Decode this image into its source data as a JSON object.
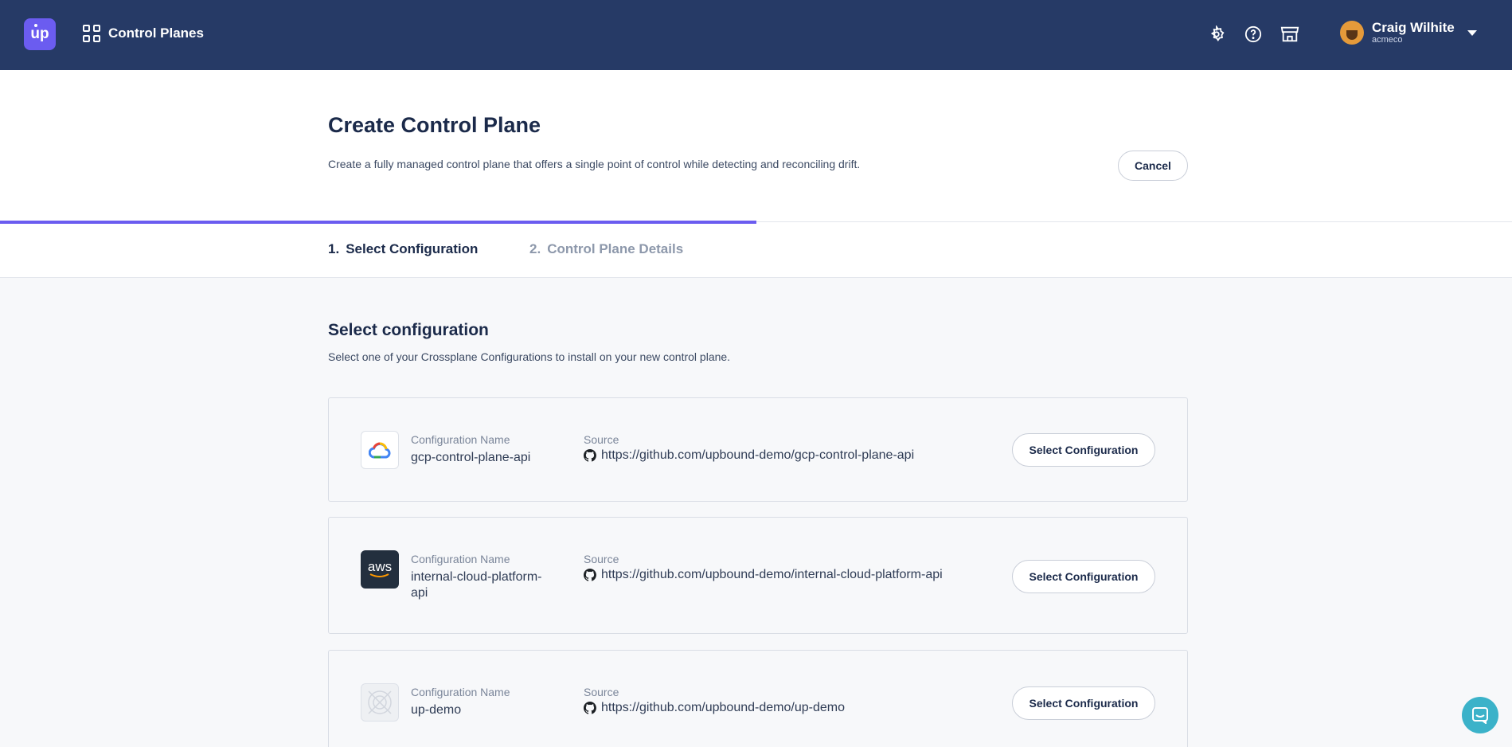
{
  "nav": {
    "logo_text": "up",
    "title": "Control Planes",
    "icons": [
      "settings-icon",
      "help-icon",
      "marketplace-icon"
    ],
    "user_name": "Craig Wilhite",
    "user_org": "acmeco"
  },
  "header": {
    "title": "Create Control Plane",
    "description": "Create a fully managed control plane that offers a single point of control while detecting and reconciling drift.",
    "cancel_label": "Cancel"
  },
  "stepper": {
    "progress": 0.5,
    "steps": [
      {
        "num": "1.",
        "label": "Select Configuration",
        "active": true
      },
      {
        "num": "2.",
        "label": "Control Plane Details",
        "active": false
      }
    ]
  },
  "main": {
    "title": "Select configuration",
    "description": "Select one of your Crossplane Configurations to install on your new control plane.",
    "name_label": "Configuration Name",
    "source_label": "Source",
    "button_label": "Select Configuration",
    "configurations": [
      {
        "icon": "gcp-icon",
        "name": "gcp-control-plane-api",
        "source": "https://github.com/upbound-demo/gcp-control-plane-api"
      },
      {
        "icon": "aws-icon",
        "icon_text": "aws",
        "name": "internal-cloud-platform-api",
        "source": "https://github.com/upbound-demo/internal-cloud-platform-api"
      },
      {
        "icon": "placeholder-icon",
        "name": "up-demo",
        "source": "https://github.com/upbound-demo/up-demo"
      }
    ]
  },
  "colors": {
    "nav_bg": "#263a66",
    "accent": "#6b5cf0",
    "chat": "#3bb2c9"
  }
}
